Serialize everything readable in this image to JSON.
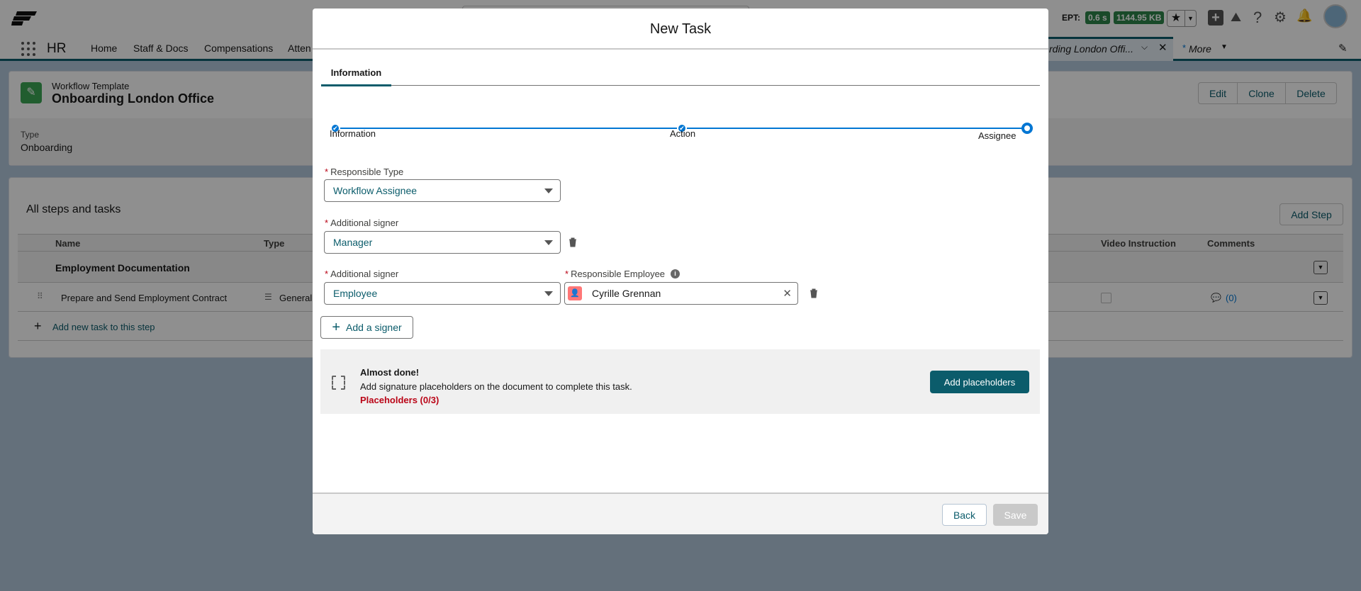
{
  "header": {
    "ept_label": "EPT:",
    "ept_time": "0.6 s",
    "ept_size": "1144.95 KB",
    "icons": [
      "star-icon",
      "add-icon",
      "trailhead-icon",
      "help-icon",
      "gear-icon",
      "bell-icon",
      "avatar"
    ]
  },
  "nav": {
    "app_name": "HR",
    "items": [
      "Home",
      "Staff & Docs",
      "Compensations",
      "Atten"
    ],
    "open_tab": "rding London Offi...",
    "more_label": "More",
    "more_marker": "*"
  },
  "record": {
    "object_label": "Workflow Template",
    "title": "Onboarding London Office",
    "actions": [
      "Edit",
      "Clone",
      "Delete"
    ],
    "field_label": "Type",
    "field_value": "Onboarding"
  },
  "steps": {
    "title": "All steps and tasks",
    "add_step": "Add Step",
    "columns": [
      "Name",
      "Type",
      "Video Instruction",
      "Comments"
    ],
    "step_name": "Employment Documentation",
    "task": {
      "name": "Prepare and Send Employment Contract",
      "type": "General",
      "comments": "(0)"
    },
    "add_task": "Add new task to this step"
  },
  "modal": {
    "title": "New Task",
    "tab": "Information",
    "progress": {
      "steps": [
        "Information",
        "Action",
        "Assignee"
      ],
      "completed": 2,
      "current": "Assignee"
    },
    "responsible_type": {
      "label": "Responsible Type",
      "value": "Workflow Assignee"
    },
    "signer1": {
      "label": "Additional signer",
      "value": "Manager"
    },
    "signer2": {
      "label": "Additional signer",
      "value": "Employee"
    },
    "responsible_employee": {
      "label": "Responsible Employee",
      "value": "Cyrille Grennan"
    },
    "add_signer": "Add a signer",
    "notice": {
      "title": "Almost done!",
      "text": "Add signature placeholders on the document to complete this task.",
      "status": "Placeholders (0/3)",
      "button": "Add placeholders"
    },
    "footer": {
      "back": "Back",
      "save": "Save"
    }
  },
  "colors": {
    "brand": "#0b5c6b",
    "progress": "#0176d3",
    "error": "#ba0517",
    "success": "#2e844a"
  }
}
